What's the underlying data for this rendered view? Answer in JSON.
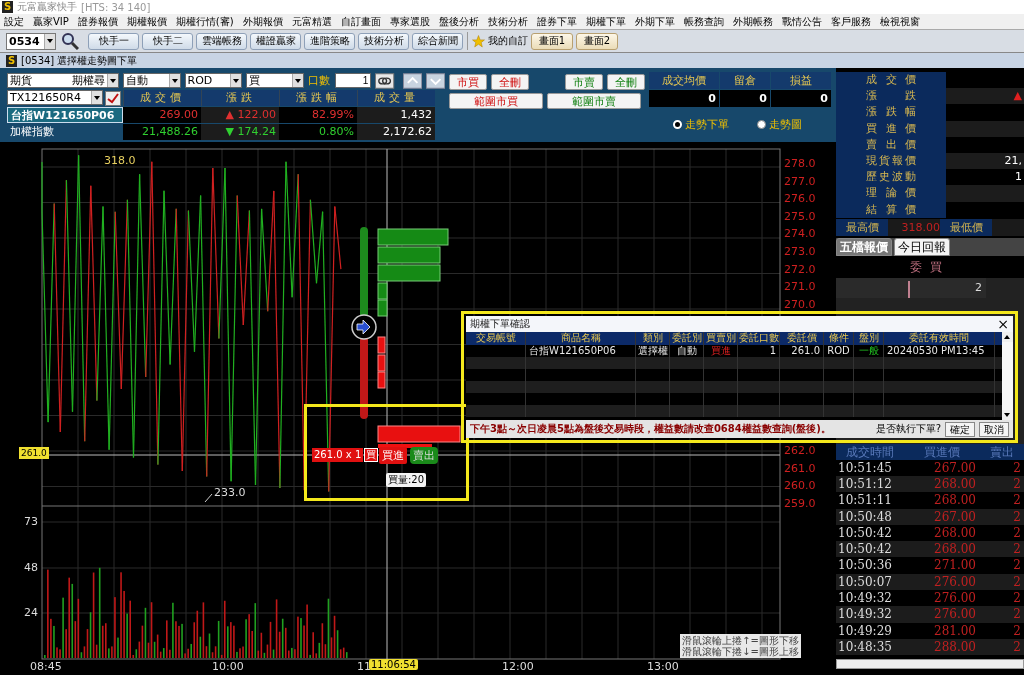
{
  "title_bar": {
    "logo": "S",
    "title": "元富贏家快手",
    "server": "[HTS: 34 140]"
  },
  "menu": [
    "設定",
    "贏家VIP",
    "證券報價",
    "期權報價",
    "期權行情(審)",
    "外期報價",
    "元富精選",
    "自訂畫面",
    "專家選股",
    "盤後分析",
    "技術分析",
    "證券下單",
    "期權下單",
    "外期下單",
    "帳務查詢",
    "外期帳務",
    "戰情公告",
    "客戶服務",
    "檢視視窗"
  ],
  "toolbar": {
    "code": "0534",
    "buttons": [
      "快手一",
      "快手二",
      "雲端帳務",
      "權證贏家",
      "進階策略",
      "技術分析",
      "綜合新聞"
    ],
    "favorites": "我的自訂",
    "screens": [
      "畫面1",
      "畫面2"
    ]
  },
  "window_logo": "S",
  "window_title": "[0534] 選擇權走勢圖下單",
  "order_panel": {
    "market": "期貨",
    "product_group": "期權尋",
    "order_type": "自動",
    "condition": "ROD",
    "side": "買",
    "qty_label": "口數",
    "qty": "1",
    "contract": "TX121650R4",
    "quote_columns": [
      "成交價",
      "漲跌",
      "漲跌幅",
      "成交量"
    ],
    "quotes": [
      {
        "name": "台指W121650P06",
        "rising": true,
        "price": "269.00",
        "change": "▲ 122.00",
        "percent": "82.99%",
        "volume": "1,432"
      },
      {
        "name": "加權指數",
        "rising": false,
        "price": "21,488.26",
        "change": "▼ 174.24",
        "percent": "0.80%",
        "volume": "2,172.62"
      }
    ],
    "action_buttons": [
      {
        "label": "市買",
        "kind": "buy"
      },
      {
        "label": "全刪",
        "kind": "buy"
      },
      {
        "label": "市賣",
        "kind": "sell"
      },
      {
        "label": "全刪",
        "kind": "sell"
      }
    ],
    "range_buttons": [
      {
        "label": "範圍市買",
        "kind": "buy"
      },
      {
        "label": "範圍市賣",
        "kind": "sell"
      }
    ],
    "position_columns": [
      "成交均價",
      "留倉",
      "損益"
    ],
    "position_values": [
      "0",
      "0",
      "0"
    ],
    "modes": [
      {
        "label": "走勢下單",
        "selected": true
      },
      {
        "label": "走勢圖",
        "selected": false
      }
    ]
  },
  "chart": {
    "high_label": "318.0",
    "low_label": "233.0",
    "current_price_tag": "261.0",
    "price_axis_upper": [
      "278.0",
      "277.0",
      "276.0",
      "275.0",
      "274.0",
      "273.0",
      "272.0",
      "271.0",
      "270.0"
    ],
    "price_axis_lower": [
      "262.0",
      "261.0",
      "260.0",
      "259.0"
    ],
    "volume_axis": [
      "73",
      "48",
      "24"
    ],
    "time_axis": [
      "08:45",
      "10:00",
      "11",
      "12:00",
      "13:00"
    ],
    "cursor_time": "11:06:54",
    "order_tag": "261.0 x 1",
    "order_side": "買",
    "buy_button": "買進",
    "sell_button": "賣出",
    "buy_volume": "買量:20",
    "hint": [
      "滑鼠滾輪上捲↑=圖形下移",
      "滑鼠滾輪下捲↓=圖形上移"
    ]
  },
  "quote_info": {
    "rows": [
      {
        "label": "成交價"
      },
      {
        "label": "漲跌",
        "value": "▲"
      },
      {
        "label": "漲跌幅"
      },
      {
        "label": "買進價"
      },
      {
        "label": "賣出價"
      },
      {
        "label": "現貨報價",
        "value": "21,"
      },
      {
        "label": "歷史波動",
        "value": "1"
      },
      {
        "label": "理論價"
      },
      {
        "label": "結算價"
      }
    ],
    "high_label": "最高價",
    "high": "318.00",
    "low_label": "最低價"
  },
  "tabs": [
    {
      "label": "五檔報價",
      "selected": true
    },
    {
      "label": "今日回報",
      "selected": false
    }
  ],
  "order_book": {
    "header": "委買",
    "rows": [
      "2"
    ]
  },
  "trades": {
    "columns": [
      "成交時間",
      "買進價",
      "賣出"
    ],
    "rows": [
      {
        "time": "10:51:45",
        "bid": "267.00",
        "ask": "2"
      },
      {
        "time": "10:51:12",
        "bid": "268.00",
        "ask": "2"
      },
      {
        "time": "10:51:11",
        "bid": "268.00",
        "ask": "2"
      },
      {
        "time": "10:50:48",
        "bid": "267.00",
        "ask": "2"
      },
      {
        "time": "10:50:42",
        "bid": "268.00",
        "ask": "2"
      },
      {
        "time": "10:50:42",
        "bid": "268.00",
        "ask": "2"
      },
      {
        "time": "10:50:36",
        "bid": "271.00",
        "ask": "2"
      },
      {
        "time": "10:50:07",
        "bid": "276.00",
        "ask": "2"
      },
      {
        "time": "10:49:32",
        "bid": "276.00",
        "ask": "2"
      },
      {
        "time": "10:49:32",
        "bid": "276.00",
        "ask": "2"
      },
      {
        "time": "10:49:29",
        "bid": "281.00",
        "ask": "2"
      },
      {
        "time": "10:48:35",
        "bid": "288.00",
        "ask": "2"
      }
    ]
  },
  "confirm_dialog": {
    "title": "期權下單確認",
    "close": "×",
    "columns": [
      "交易帳號",
      "商品名稱",
      "類別",
      "委託別",
      "買賣別",
      "委託口數",
      "委託價",
      "條件",
      "盤別",
      "委託有效時間"
    ],
    "rows": [
      {
        "product": "台指W121650P06",
        "category": "選擇權",
        "order_type": "自動",
        "side": "買進",
        "qty": "1",
        "price": "261.0",
        "condition": "ROD",
        "session": "一般",
        "valid_until": "20240530 PM13:45"
      }
    ],
    "message": "下午3點～次日凌晨5點為盤後交易時段，權益數請改查0684權益數查詢(盤後)。",
    "question": "是否執行下單?",
    "confirm": "確定",
    "cancel": "取消"
  }
}
